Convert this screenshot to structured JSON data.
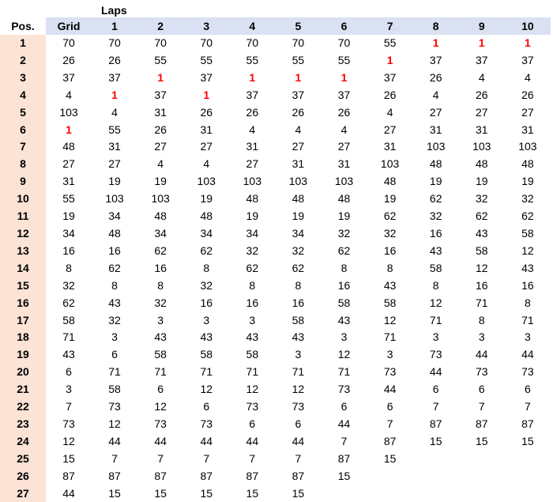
{
  "header": {
    "laps_label": "Laps",
    "pos_label": "Pos.",
    "columns": [
      "Grid",
      "1",
      "2",
      "3",
      "4",
      "5",
      "6",
      "7",
      "8",
      "9",
      "10"
    ]
  },
  "leader_value": "1",
  "rows": [
    [
      "1",
      "70",
      "70",
      "70",
      "70",
      "70",
      "70",
      "70",
      "55",
      "1",
      "1",
      "1"
    ],
    [
      "2",
      "26",
      "26",
      "55",
      "55",
      "55",
      "55",
      "55",
      "1",
      "37",
      "37",
      "37"
    ],
    [
      "3",
      "37",
      "37",
      "1",
      "37",
      "1",
      "1",
      "1",
      "37",
      "26",
      "4",
      "4"
    ],
    [
      "4",
      "4",
      "1",
      "37",
      "1",
      "37",
      "37",
      "37",
      "26",
      "4",
      "26",
      "26"
    ],
    [
      "5",
      "103",
      "4",
      "31",
      "26",
      "26",
      "26",
      "26",
      "4",
      "27",
      "27",
      "27"
    ],
    [
      "6",
      "1",
      "55",
      "26",
      "31",
      "4",
      "4",
      "4",
      "27",
      "31",
      "31",
      "31"
    ],
    [
      "7",
      "48",
      "31",
      "27",
      "27",
      "31",
      "27",
      "27",
      "31",
      "103",
      "103",
      "103"
    ],
    [
      "8",
      "27",
      "27",
      "4",
      "4",
      "27",
      "31",
      "31",
      "103",
      "48",
      "48",
      "48"
    ],
    [
      "9",
      "31",
      "19",
      "19",
      "103",
      "103",
      "103",
      "103",
      "48",
      "19",
      "19",
      "19"
    ],
    [
      "10",
      "55",
      "103",
      "103",
      "19",
      "48",
      "48",
      "48",
      "19",
      "62",
      "32",
      "32"
    ],
    [
      "11",
      "19",
      "34",
      "48",
      "48",
      "19",
      "19",
      "19",
      "62",
      "32",
      "62",
      "62"
    ],
    [
      "12",
      "34",
      "48",
      "34",
      "34",
      "34",
      "34",
      "32",
      "32",
      "16",
      "43",
      "58"
    ],
    [
      "13",
      "16",
      "16",
      "62",
      "62",
      "32",
      "32",
      "62",
      "16",
      "43",
      "58",
      "12"
    ],
    [
      "14",
      "8",
      "62",
      "16",
      "8",
      "62",
      "62",
      "8",
      "8",
      "58",
      "12",
      "43"
    ],
    [
      "15",
      "32",
      "8",
      "8",
      "32",
      "8",
      "8",
      "16",
      "43",
      "8",
      "16",
      "16"
    ],
    [
      "16",
      "62",
      "43",
      "32",
      "16",
      "16",
      "16",
      "58",
      "58",
      "12",
      "71",
      "8"
    ],
    [
      "17",
      "58",
      "32",
      "3",
      "3",
      "3",
      "58",
      "43",
      "12",
      "71",
      "8",
      "71"
    ],
    [
      "18",
      "71",
      "3",
      "43",
      "43",
      "43",
      "43",
      "3",
      "71",
      "3",
      "3",
      "3"
    ],
    [
      "19",
      "43",
      "6",
      "58",
      "58",
      "58",
      "3",
      "12",
      "3",
      "73",
      "44",
      "44"
    ],
    [
      "20",
      "6",
      "71",
      "71",
      "71",
      "71",
      "71",
      "71",
      "73",
      "44",
      "73",
      "73"
    ],
    [
      "21",
      "3",
      "58",
      "6",
      "12",
      "12",
      "12",
      "73",
      "44",
      "6",
      "6",
      "6"
    ],
    [
      "22",
      "7",
      "73",
      "12",
      "6",
      "73",
      "73",
      "6",
      "6",
      "7",
      "7",
      "7"
    ],
    [
      "23",
      "73",
      "12",
      "73",
      "73",
      "6",
      "6",
      "44",
      "7",
      "87",
      "87",
      "87"
    ],
    [
      "24",
      "12",
      "44",
      "44",
      "44",
      "44",
      "44",
      "7",
      "87",
      "15",
      "15",
      "15"
    ],
    [
      "25",
      "15",
      "7",
      "7",
      "7",
      "7",
      "7",
      "87",
      "15",
      "",
      "",
      ""
    ],
    [
      "26",
      "87",
      "87",
      "87",
      "87",
      "87",
      "87",
      "15",
      "",
      "",
      "",
      ""
    ],
    [
      "27",
      "44",
      "15",
      "15",
      "15",
      "15",
      "15",
      "",
      "",
      "",
      "",
      ""
    ]
  ],
  "colors": {
    "header_bg": "#d9e1f2",
    "pos_bg": "#fbe3d6",
    "leader_text": "#ff0000"
  }
}
